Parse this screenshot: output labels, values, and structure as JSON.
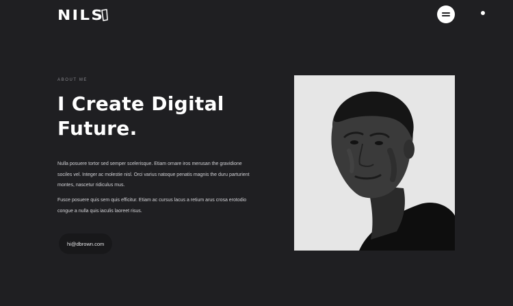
{
  "header": {
    "logo_text": "NILS",
    "menu_icon": "hamburger-icon"
  },
  "hero": {
    "eyebrow": "ABOUT ME",
    "title_line1": "I Create Digital",
    "title_line2": "Future.",
    "paragraph1": "Nulla posuere tortor sed semper scelerisque. Etiam ornare iros merusan the gravidione sociles vel. Integer ac molestie nisl. Orci varius natoque penatis magnis the duru parturient montes, nascetur ridiculus mus.",
    "paragraph2": "Fusce posuere quis sem quis efficitur. Etiam ac cursus lacus a retium arus crosa erotodio congue a nulla quis iaculis laoreet risus.",
    "contact_email": "hi@dbrown.com"
  },
  "portrait": {
    "icon": "portrait-photo",
    "background_color": "#e6e6e6"
  },
  "colors": {
    "background": "#1f1f22",
    "text": "#ffffff",
    "muted": "#8a8a8f"
  }
}
